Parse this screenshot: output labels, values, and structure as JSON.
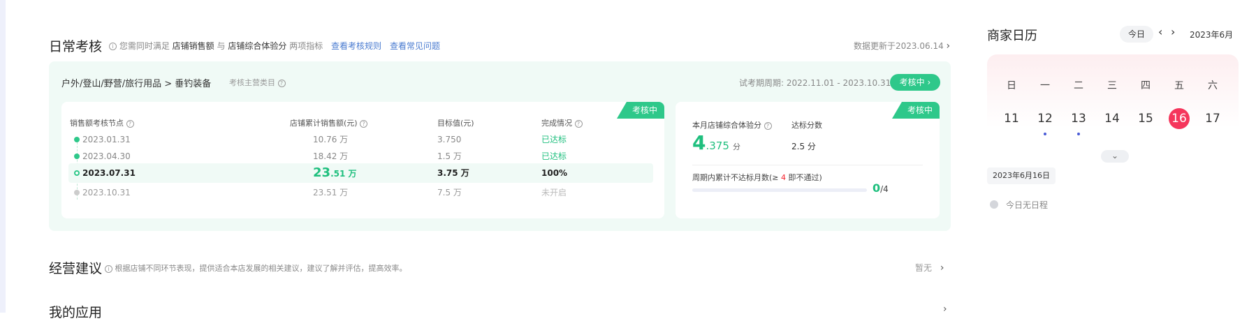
{
  "daily_check": {
    "title": "日常考核",
    "tip_prefix": "您需同时满足",
    "metric1": "店铺销售额",
    "tip_and": "与",
    "metric2": "店铺综合体验分",
    "tip_suffix": "两项指标",
    "link_rules": "查看考核规则",
    "link_faq": "查看常见问题",
    "update_text": "数据更新于2023.06.14",
    "category_path": "户外/登山/野营/旅行用品 > 垂钓装备",
    "category_hint": "考核主营类目",
    "trial_period": "试考期周期: 2022.11.01 - 2023.10.31",
    "status_pill": "考核中",
    "sales_panel": {
      "badge": "考核中",
      "headers": [
        "销售额考核节点",
        "店铺累计销售额(元)",
        "目标值(元)",
        "完成情况"
      ],
      "rows": [
        {
          "date": "2023.01.31",
          "sales": "10.76 万",
          "target": "3.750",
          "status": "已达标"
        },
        {
          "date": "2023.04.30",
          "sales": "18.42 万",
          "target": "1.5 万",
          "status": "已达标"
        },
        {
          "date": "2023.07.31",
          "sales_big": "23",
          "sales_small": ".51 万",
          "target": "3.75 万",
          "status": "100%"
        },
        {
          "date": "2023.10.31",
          "sales": "23.51 万",
          "target": "7.5 万",
          "status": "未开启"
        }
      ]
    },
    "score_panel": {
      "badge": "考核中",
      "score_label": "本月店铺综合体验分",
      "standard_label": "达标分数",
      "score_int": "4",
      "score_dec": ".375",
      "score_unit": "分",
      "standard_value": "2.5 分",
      "fail_label_pre": "周期内累计不达标月数(≥",
      "fail_num": "4",
      "fail_label_post": "即不通过)",
      "progress_value": "0",
      "progress_total": "/4",
      "progress_fraction": 0
    }
  },
  "suggestion": {
    "title": "经营建议",
    "tip": "根据店铺不同环节表现，提供适合本店发展的相关建议，建议了解并评估，提高效率。",
    "status": "暂无"
  },
  "my_apps": {
    "title": "我的应用"
  },
  "calendar": {
    "title": "商家日历",
    "today_button": "今日",
    "prev_icon": "‹",
    "next_icon": "›",
    "month_label": "2023年6月",
    "weekdays": [
      "日",
      "一",
      "二",
      "三",
      "四",
      "五",
      "六"
    ],
    "days": [
      "11",
      "12",
      "13",
      "14",
      "15",
      "16",
      "17"
    ],
    "selected_date_label": "2023年6月16日",
    "empty_text": "今日无日程"
  },
  "colors": {
    "accent": "#2ec88a",
    "today": "#f5365c",
    "link": "#4a7bd0"
  }
}
